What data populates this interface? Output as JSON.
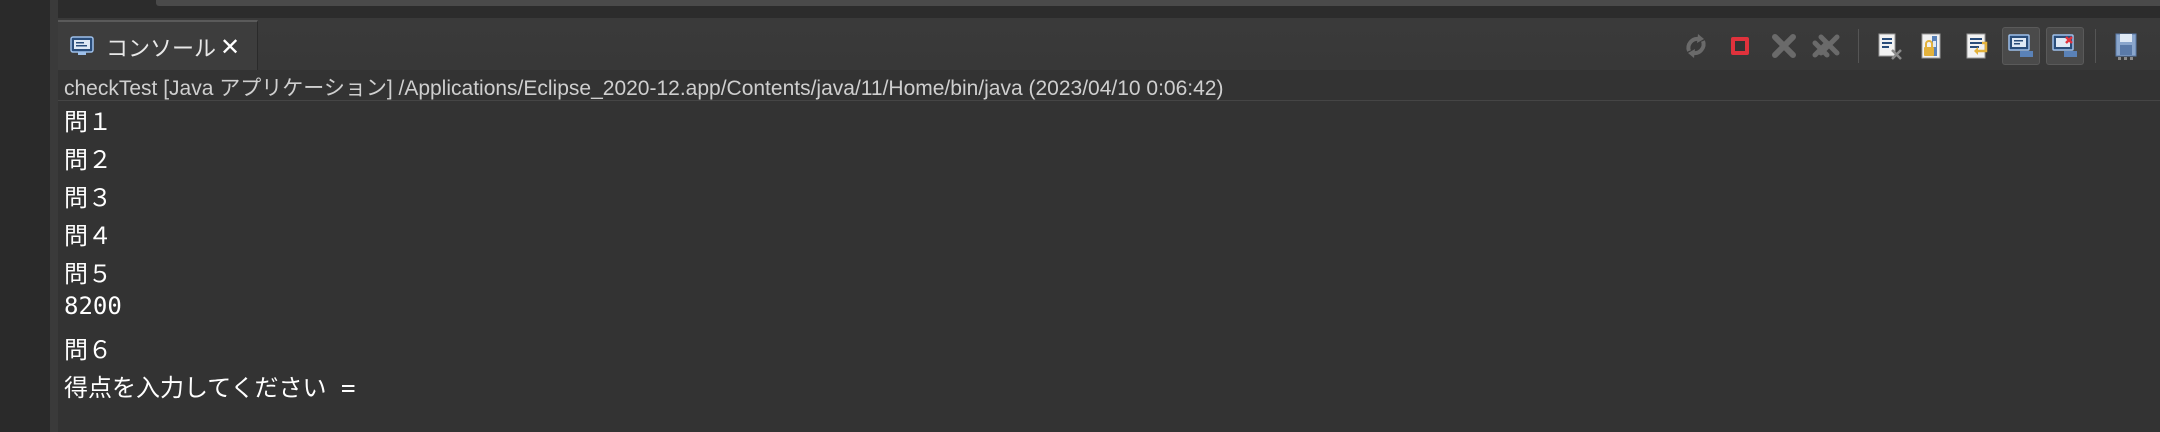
{
  "tab": {
    "label": "コンソール",
    "close_glyph": "✕"
  },
  "toolbar": {
    "icons": [
      "terminate-relaunch-icon",
      "terminate-icon",
      "remove-launch-icon",
      "remove-all-terminated-icon",
      "clear-console-icon",
      "scroll-lock-icon",
      "word-wrap-icon",
      "show-on-stdout-icon",
      "show-on-stderr-icon",
      "pin-console-icon"
    ]
  },
  "console": {
    "header": "checkTest [Java アプリケーション] /Applications/Eclipse_2020-12.app/Contents/java/11/Home/bin/java  (2023/04/10 0:06:42)",
    "lines": [
      "問１",
      "問２",
      "問３",
      "問４",
      "問５",
      "8200",
      "問６",
      "得点を入力してください ="
    ]
  },
  "colors": {
    "terminate_red": "#e0323c",
    "background": "#333333",
    "text": "#ffffff"
  }
}
